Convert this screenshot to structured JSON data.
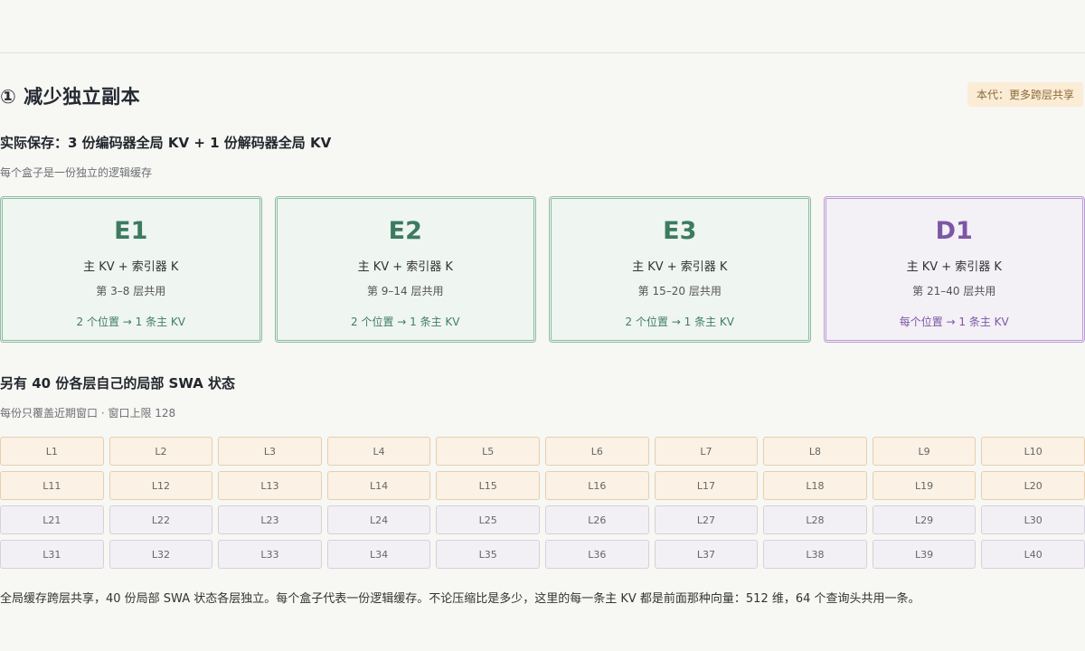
{
  "header": {
    "title": "① 减少独立副本",
    "badge": "本代：更多跨层共享"
  },
  "section1": {
    "heading": "实际保存：3 份编码器全局 KV + 1 份解码器全局 KV",
    "subtitle": "每个盒子是一份独立的逻辑缓存",
    "cards": [
      {
        "name": "E1",
        "main": "主 KV + 索引器 K",
        "layers": "第 3–8 层共用",
        "mapping": "2 个位置 → 1 条主 KV",
        "kind": "encoder"
      },
      {
        "name": "E2",
        "main": "主 KV + 索引器 K",
        "layers": "第 9–14 层共用",
        "mapping": "2 个位置 → 1 条主 KV",
        "kind": "encoder"
      },
      {
        "name": "E3",
        "main": "主 KV + 索引器 K",
        "layers": "第 15–20 层共用",
        "mapping": "2 个位置 → 1 条主 KV",
        "kind": "encoder"
      },
      {
        "name": "D1",
        "main": "主 KV + 索引器 K",
        "layers": "第 21–40 层共用",
        "mapping": "每个位置 → 1 条主 KV",
        "kind": "decoder"
      }
    ]
  },
  "section2": {
    "heading": "另有 40 份各层自己的局部 SWA 状态",
    "subtitle": "每份只覆盖近期窗口 · 窗口上限 128",
    "layers": [
      "L1",
      "L2",
      "L3",
      "L4",
      "L5",
      "L6",
      "L7",
      "L8",
      "L9",
      "L10",
      "L11",
      "L12",
      "L13",
      "L14",
      "L15",
      "L16",
      "L17",
      "L18",
      "L19",
      "L20",
      "L21",
      "L22",
      "L23",
      "L24",
      "L25",
      "L26",
      "L27",
      "L28",
      "L29",
      "L30",
      "L31",
      "L32",
      "L33",
      "L34",
      "L35",
      "L36",
      "L37",
      "L38",
      "L39",
      "L40"
    ],
    "warm_count": 20
  },
  "footer": {
    "text": "全局缓存跨层共享，40 份局部 SWA 状态各层独立。每个盒子代表一份逻辑缓存。不论压缩比是多少，这里的每一条主 KV 都是前面那种向量：512 维，64 个查询头共用一条。"
  },
  "colors": {
    "encoder": "#3c7b60",
    "decoder": "#7d56a6",
    "warm_cell": "#fbf1e4",
    "cool_cell": "#f2f0f5",
    "badge": "#fbecd6"
  }
}
